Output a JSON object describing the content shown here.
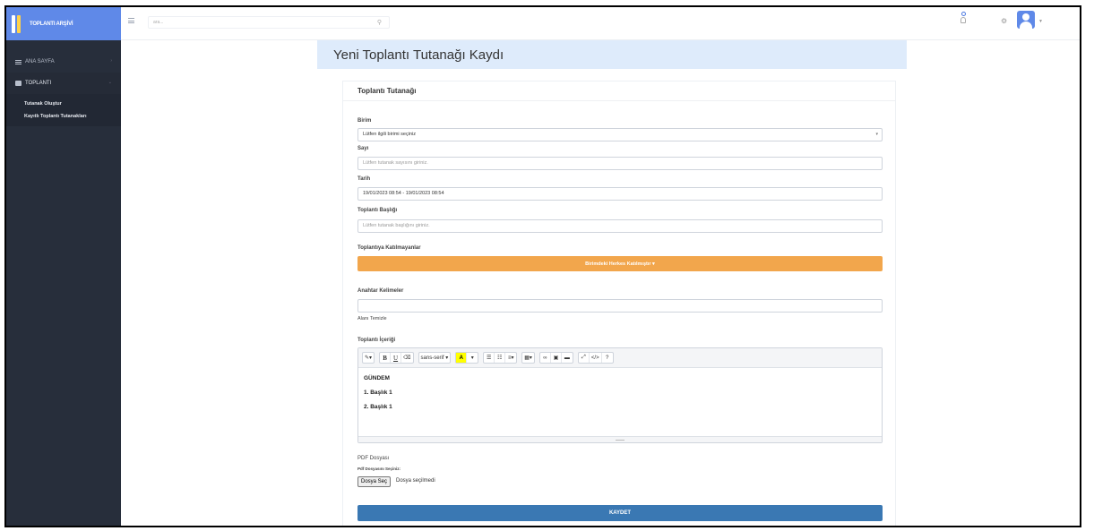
{
  "brand": {
    "name": "TOPLANTI ARŞİVİ"
  },
  "topbar": {
    "search_placeholder": "ara..."
  },
  "sidebar": {
    "items": [
      {
        "label": "ANA SAYFA",
        "icon": "list-icon"
      },
      {
        "label": "TOPLANTI",
        "icon": "book-icon"
      }
    ],
    "submenu": [
      {
        "label": "Tutanak Oluştur"
      },
      {
        "label": "Kayıtlı Toplantı Tutanakları"
      }
    ]
  },
  "page": {
    "title": "Yeni Toplantı Tutanağı Kaydı"
  },
  "card": {
    "title": "Toplantı Tutanağı"
  },
  "form": {
    "birim_label": "Birim",
    "birim_value": "Lütfen ilgili birimi seçiniz",
    "sayi_label": "Sayı",
    "sayi_placeholder": "Lütfen tutanak sayısını giriniz.",
    "tarih_label": "Tarih",
    "tarih_value": "19/01/2023 08:54 - 19/01/2023 08:54",
    "baslik_label": "Toplantı Başlığı",
    "baslik_placeholder": "Lütfen tutanak başlığını giriniz.",
    "katilmayanlar_label": "Toplantıya Katılmayanlar",
    "katilmayanlar_button": "Birimdeki Herkes Katılmıştır",
    "anahtar_label": "Anahtar Kelimeler",
    "anahtar_value": "",
    "alani_temizle": "Alanı Temizle",
    "icerik_label": "Toplantı İçeriği",
    "editor_font": "sans-serif",
    "editor_lines": [
      "GÜNDEM",
      "1. Başlık 1",
      "2. Başlık 1"
    ],
    "pdf_label": "PDF Dosyası",
    "pdf_sublabel": "Pdf Dosyasını Seçiniz:",
    "file_button": "Dosya Seç",
    "file_status": "Dosya seçilmedi",
    "save_button": "KAYDET"
  }
}
